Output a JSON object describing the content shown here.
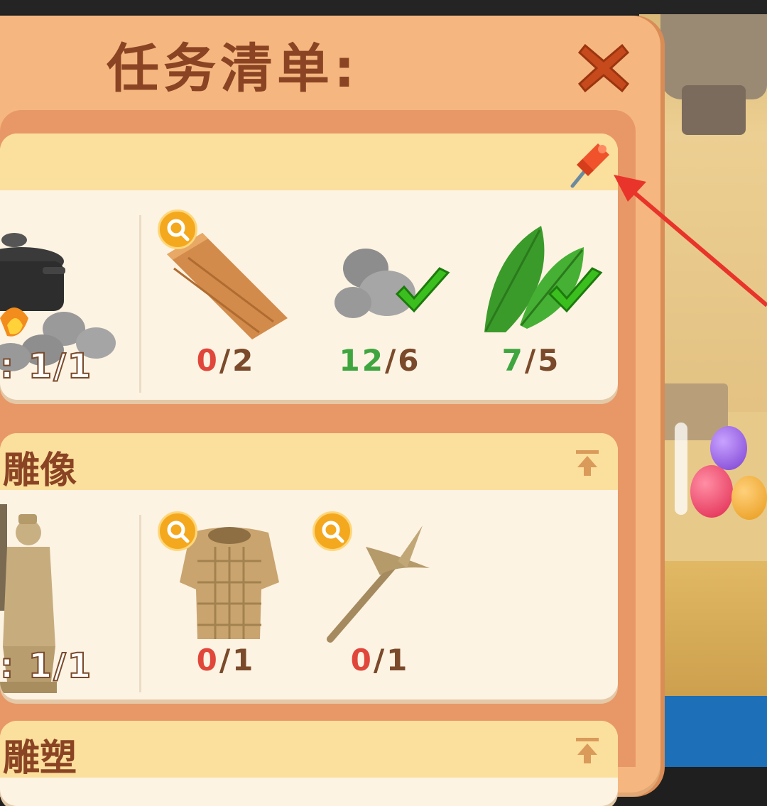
{
  "panel": {
    "title": "任务清单:",
    "close_icon": "close-icon",
    "pin_icon": "pin-icon"
  },
  "tasks": [
    {
      "title": "",
      "progress": ": 1/1",
      "main_item": "campfire-pot",
      "materials": [
        {
          "icon": "wood-plank-icon",
          "have": "0",
          "need": "/2",
          "complete": false,
          "searchable": true
        },
        {
          "icon": "stone-icon",
          "have": "12",
          "need": "/6",
          "complete": true,
          "searchable": false
        },
        {
          "icon": "leaf-icon",
          "have": "7",
          "need": "/5",
          "complete": true,
          "searchable": false
        }
      ]
    },
    {
      "title": "雕像",
      "progress": ": 1/1",
      "main_item": "terracotta-statue",
      "materials": [
        {
          "icon": "armor-icon",
          "have": "0",
          "need": "/1",
          "complete": false,
          "searchable": true
        },
        {
          "icon": "spear-icon",
          "have": "0",
          "need": "/1",
          "complete": false,
          "searchable": true
        }
      ]
    },
    {
      "title": "雕塑"
    }
  ],
  "colors": {
    "panel": "#f5b77f",
    "title": "#8a4424",
    "header": "#fbdf9c",
    "card": "#fdf3e3",
    "red": "#e0473a",
    "green": "#3fa63f",
    "arrow": "#e8342a"
  }
}
